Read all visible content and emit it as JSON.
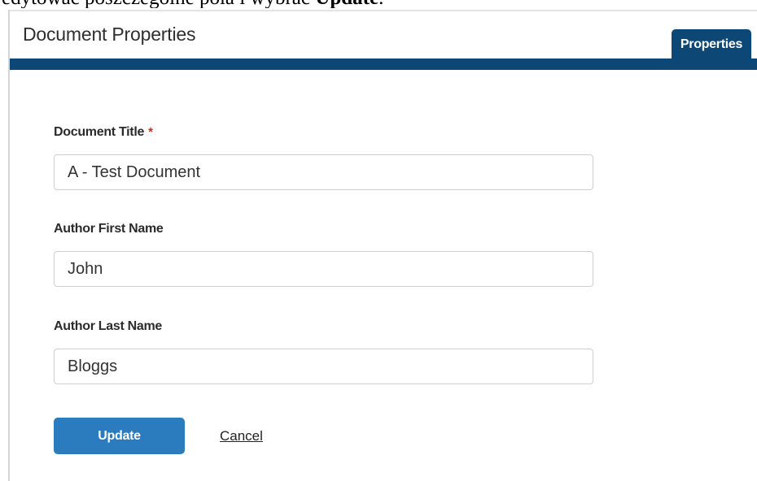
{
  "caption": {
    "text": "edytować poszczególne pola i wybrać ",
    "bold": "Update",
    "end": "."
  },
  "header": {
    "title": "Document Properties",
    "tab_label": "Properties"
  },
  "form": {
    "title_label": "Document Title",
    "required_marker": "*",
    "title_value": "A - Test Document",
    "first_name_label": "Author First Name",
    "first_name_value": "John",
    "last_name_label": "Author Last Name",
    "last_name_value": "Bloggs"
  },
  "actions": {
    "update_label": "Update",
    "cancel_label": "Cancel"
  },
  "colors": {
    "header_bar": "#0d4775",
    "primary_button": "#2b7bbf",
    "required": "#e02020"
  }
}
